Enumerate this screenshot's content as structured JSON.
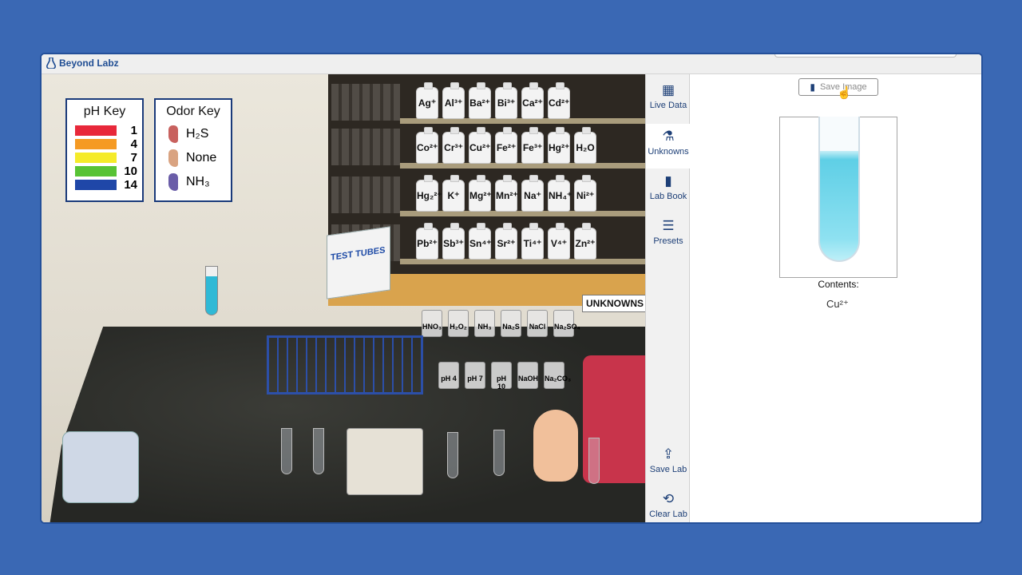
{
  "app": {
    "brand": "Beyond Labz"
  },
  "ph_key": {
    "title": "pH Key",
    "rows": [
      {
        "value": "1",
        "color": "#e8283a"
      },
      {
        "value": "4",
        "color": "#f59a23"
      },
      {
        "value": "7",
        "color": "#f5eb2a"
      },
      {
        "value": "10",
        "color": "#58c335"
      },
      {
        "value": "14",
        "color": "#1f47a8"
      }
    ]
  },
  "odor_key": {
    "title": "Odor Key",
    "rows": [
      {
        "label": "H₂S",
        "color": "#c8615e"
      },
      {
        "label": "None",
        "color": "#d9a381"
      },
      {
        "label": "NH₃",
        "color": "#6a5da8"
      }
    ]
  },
  "shelves": [
    [
      "Ag⁺",
      "Al³⁺",
      "Ba²⁺",
      "Bi³⁺",
      "Ca²⁺",
      "Cd²⁺"
    ],
    [
      "Co²⁺",
      "Cr³⁺",
      "Cu²⁺",
      "Fe²⁺",
      "Fe³⁺",
      "Hg²⁺",
      "H₂O"
    ],
    [
      "Hg₂²⁺",
      "K⁺",
      "Mg²⁺",
      "Mn²⁺",
      "Na⁺",
      "NH₄⁺",
      "Ni²⁺"
    ],
    [
      "Pb²⁺",
      "Sb³⁺",
      "Sn⁴⁺",
      "Sr²⁺",
      "Ti⁴⁺",
      "V⁴⁺",
      "Zn²⁺"
    ]
  ],
  "reagents_top": [
    "HNO₃",
    "H₂O₂",
    "NH₃",
    "Na₂S",
    "NaCl",
    "Na₂SO₄"
  ],
  "reagents_bottom": [
    "pH 4",
    "pH 7",
    "pH 10",
    "NaOH",
    "Na₂CO₃"
  ],
  "scene": {
    "test_tubes_box": "TEST TUBES",
    "unknowns_tag": "UNKNOWNS"
  },
  "toolbar": {
    "items": [
      {
        "label": "Live Data",
        "icon": "grid-icon"
      },
      {
        "label": "Unknowns",
        "icon": "flask-icon"
      },
      {
        "label": "Lab Book",
        "icon": "book-icon"
      },
      {
        "label": "Presets",
        "icon": "list-icon"
      }
    ],
    "bottom": [
      {
        "label": "Save Lab",
        "icon": "upload-icon"
      },
      {
        "label": "Clear Lab",
        "icon": "refresh-icon"
      }
    ]
  },
  "panel": {
    "save_image_label": "Save Image",
    "contents_label": "Contents:",
    "contents_value": "Cu²⁺",
    "solution_color": "#5fcfe6"
  }
}
